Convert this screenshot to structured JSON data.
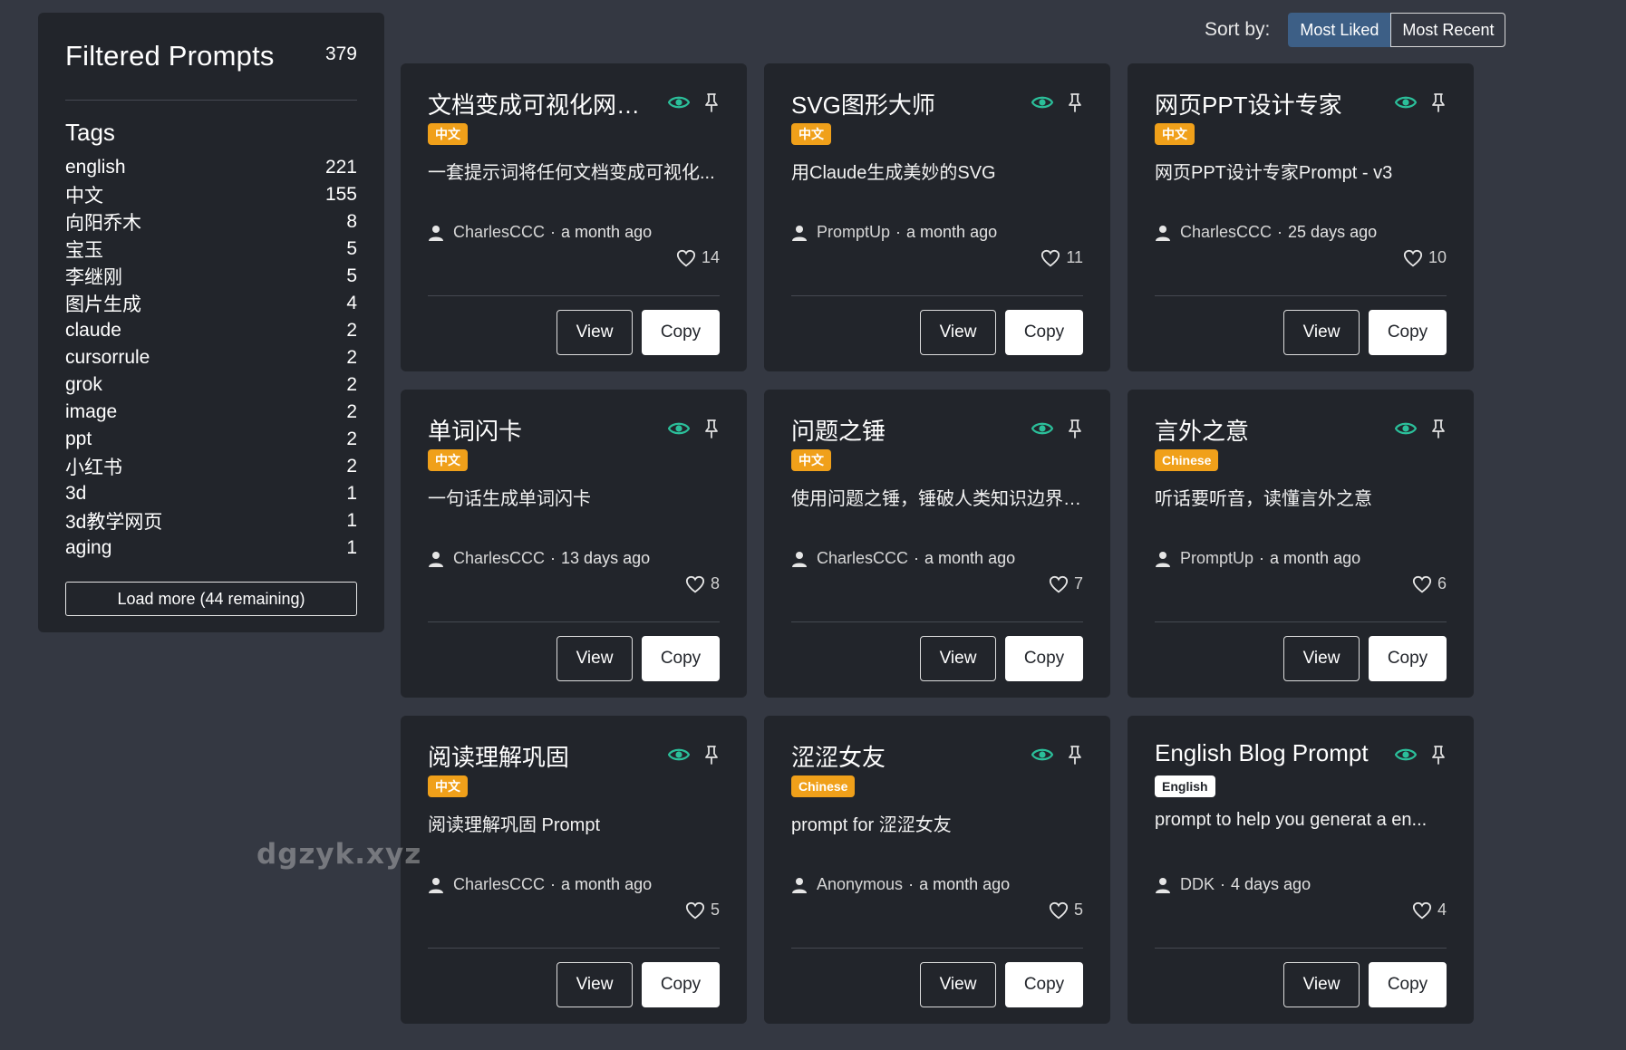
{
  "sidebar": {
    "title": "Filtered Prompts",
    "total_count": "379",
    "tags_title": "Tags",
    "tags": [
      {
        "name": "english",
        "count": "221"
      },
      {
        "name": "中文",
        "count": "155"
      },
      {
        "name": "向阳乔木",
        "count": "8"
      },
      {
        "name": "宝玉",
        "count": "5"
      },
      {
        "name": "李继刚",
        "count": "5"
      },
      {
        "name": "图片生成",
        "count": "4"
      },
      {
        "name": "claude",
        "count": "2"
      },
      {
        "name": "cursorrule",
        "count": "2"
      },
      {
        "name": "grok",
        "count": "2"
      },
      {
        "name": "image",
        "count": "2"
      },
      {
        "name": "ppt",
        "count": "2"
      },
      {
        "name": "小红书",
        "count": "2"
      },
      {
        "name": "3d",
        "count": "1"
      },
      {
        "name": "3d教学网页",
        "count": "1"
      },
      {
        "name": "aging",
        "count": "1"
      }
    ],
    "load_more_label": "Load more (44 remaining)"
  },
  "sort": {
    "label": "Sort by:",
    "options": [
      "Most Liked",
      "Most Recent"
    ],
    "active": "Most Liked"
  },
  "cards": [
    {
      "title": "文档变成可视化网页...",
      "badge": "中文",
      "badge_style": "orange",
      "description": "一套提示词将任何文档变成可视化...",
      "author": "CharlesCCC",
      "time": "a month ago",
      "likes": "14",
      "view_label": "View",
      "copy_label": "Copy"
    },
    {
      "title": "SVG图形大师",
      "badge": "中文",
      "badge_style": "orange",
      "description": "用Claude生成美妙的SVG",
      "author": "PromptUp",
      "time": "a month ago",
      "likes": "11",
      "view_label": "View",
      "copy_label": "Copy"
    },
    {
      "title": "网页PPT设计专家",
      "badge": "中文",
      "badge_style": "orange",
      "description": "网页PPT设计专家Prompt - v3",
      "author": "CharlesCCC",
      "time": "25 days ago",
      "likes": "10",
      "view_label": "View",
      "copy_label": "Copy"
    },
    {
      "title": "单词闪卡",
      "badge": "中文",
      "badge_style": "orange",
      "description": "一句话生成单词闪卡",
      "author": "CharlesCCC",
      "time": "13 days ago",
      "likes": "8",
      "view_label": "View",
      "copy_label": "Copy"
    },
    {
      "title": "问题之锤",
      "badge": "中文",
      "badge_style": "orange",
      "description": "使用问题之锤，锤破人类知识边界，...",
      "author": "CharlesCCC",
      "time": "a month ago",
      "likes": "7",
      "view_label": "View",
      "copy_label": "Copy"
    },
    {
      "title": "言外之意",
      "badge": "Chinese",
      "badge_style": "orange",
      "description": "听话要听音，读懂言外之意",
      "author": "PromptUp",
      "time": "a month ago",
      "likes": "6",
      "view_label": "View",
      "copy_label": "Copy"
    },
    {
      "title": "阅读理解巩固",
      "badge": "中文",
      "badge_style": "orange",
      "description": "阅读理解巩固 Prompt",
      "author": "CharlesCCC",
      "time": "a month ago",
      "likes": "5",
      "view_label": "View",
      "copy_label": "Copy"
    },
    {
      "title": "涩涩女友",
      "badge": "Chinese",
      "badge_style": "orange",
      "description": "prompt for 涩涩女友",
      "author": "Anonymous",
      "time": "a month ago",
      "likes": "5",
      "view_label": "View",
      "copy_label": "Copy"
    },
    {
      "title": "English Blog Prompt",
      "badge": "English",
      "badge_style": "light",
      "description": "prompt to help you generat a en...",
      "author": "DDK",
      "time": "4 days ago",
      "likes": "4",
      "view_label": "View",
      "copy_label": "Copy"
    }
  ],
  "watermark": "dgzyk.xyz",
  "colors": {
    "accent": "#3d5f86",
    "badge": "#f0a01a",
    "eye_icon": "#2bbf9a",
    "card_bg": "#22252b",
    "page_bg": "#343842"
  },
  "icons": {
    "views": "eye-icon",
    "pin": "pin-icon",
    "author": "user-icon",
    "likes": "heart-icon"
  }
}
